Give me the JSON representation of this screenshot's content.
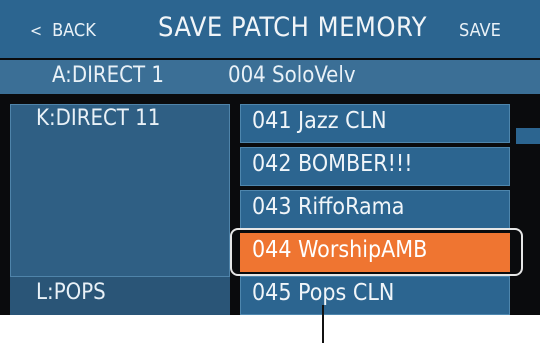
{
  "header": {
    "back_icon": "chevron-left-icon",
    "back_glyph": "<",
    "back_label": "BACK",
    "title": "SAVE PATCH MEMORY",
    "save_label": "SAVE"
  },
  "current": {
    "bank": "A:DIRECT 1",
    "patch": "004 SoloVelv"
  },
  "banks": {
    "top": "K:DIRECT 11",
    "bottom": "L:POPS"
  },
  "patches": [
    {
      "label": "041 Jazz CLN"
    },
    {
      "label": "042 BOMBER!!!"
    },
    {
      "label": "043 RiffoRama"
    },
    {
      "label": "044 WorshipAMB",
      "selected": true
    },
    {
      "label": "045 Pops CLN"
    }
  ],
  "colors": {
    "header_bg": "#2c6590",
    "selected_bg": "#ef7531",
    "screen_bg": "#0a0b0d"
  }
}
